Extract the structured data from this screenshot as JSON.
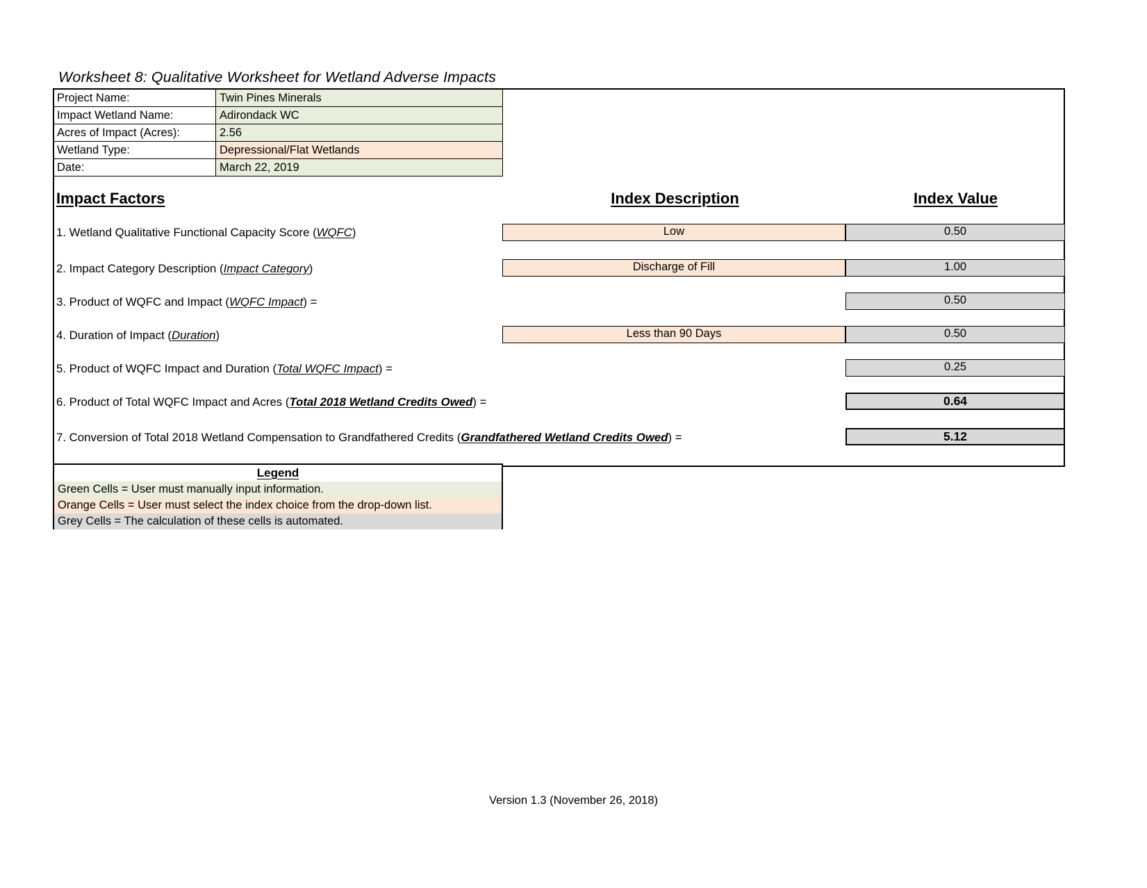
{
  "worksheet": {
    "title": "Worksheet 8:  Qualitative Worksheet for Wetland Adverse Impacts"
  },
  "info": {
    "rows": [
      {
        "label": "Project Name:",
        "value": "Twin Pines Minerals",
        "cell_type": "green"
      },
      {
        "label": "Impact Wetland Name:",
        "value": "Adirondack WC",
        "cell_type": "green"
      },
      {
        "label": "Acres of Impact (Acres):",
        "value": "2.56",
        "cell_type": "green"
      },
      {
        "label": "Wetland Type:",
        "value": "Depressional/Flat Wetlands",
        "cell_type": "orange"
      },
      {
        "label": "Date:",
        "value": "March 22, 2019",
        "cell_type": "green"
      }
    ]
  },
  "headers": {
    "impact_factors": "Impact Factors",
    "index_description": "Index Description",
    "index_value": "Index Value"
  },
  "factors": [
    {
      "number": "1.",
      "text_before": "1. Wetland Qualitative Functional Capacity Score (",
      "term": "WQFC",
      "term_style": "italic-underline",
      "text_after": ")",
      "description": "Low",
      "value": "0.50",
      "has_description": true,
      "value_emphasis": false
    },
    {
      "number": "2.",
      "text_before": "2. Impact Category Description (",
      "term": "Impact Category",
      "term_style": "italic-underline",
      "text_after": ")",
      "description": "Discharge of Fill",
      "value": "1.00",
      "has_description": true,
      "value_emphasis": false
    },
    {
      "number": "3.",
      "text_before": "3. Product of WQFC and Impact (",
      "term": "WQFC Impact",
      "term_style": "italic-underline",
      "text_after": ") =",
      "description": "",
      "value": "0.50",
      "has_description": false,
      "value_emphasis": false
    },
    {
      "number": "4.",
      "text_before": "4. Duration of Impact (",
      "term": "Duration",
      "term_style": "italic-underline",
      "text_after": ")",
      "description": "Less than 90 Days",
      "value": "0.50",
      "has_description": true,
      "value_emphasis": false
    },
    {
      "number": "5.",
      "text_before": "5. Product of WQFC Impact and Duration (",
      "term": "Total WQFC Impact",
      "term_style": "italic-underline",
      "text_after": ") =",
      "description": "",
      "value": "0.25",
      "has_description": false,
      "value_emphasis": false
    },
    {
      "number": "6.",
      "text_before": "6. Product of Total WQFC Impact and Acres (",
      "term": "Total 2018 Wetland Credits Owed",
      "term_style": "bold-italic-underline",
      "text_after": ") =",
      "description": "",
      "value": "0.64",
      "has_description": false,
      "value_emphasis": true
    },
    {
      "number": "7.",
      "text_before": "7. Conversion of Total 2018 Wetland Compensation to Grandfathered Credits (",
      "term": "Grandfathered Wetland Credits Owed",
      "term_style": "bold-italic-underline",
      "text_after": ") =",
      "description": "",
      "value": "5.12",
      "has_description": false,
      "value_emphasis": true
    }
  ],
  "legend": {
    "title": "Legend",
    "rows": [
      {
        "text": "Green Cells = User must manually input information.",
        "cell_type": "green"
      },
      {
        "text": "Orange Cells = User must select the index choice from the drop-down list.",
        "cell_type": "orange"
      },
      {
        "text": "Grey Cells = The calculation of these cells is automated.",
        "cell_type": "grey"
      }
    ]
  },
  "footer": {
    "version": "Version 1.3 (November 26, 2018)"
  },
  "colors": {
    "green_cell": "#e9eedc",
    "orange_cell": "#fce6d5",
    "grey_cell": "#d9d9d9",
    "border": "#000000",
    "background": "#ffffff"
  }
}
